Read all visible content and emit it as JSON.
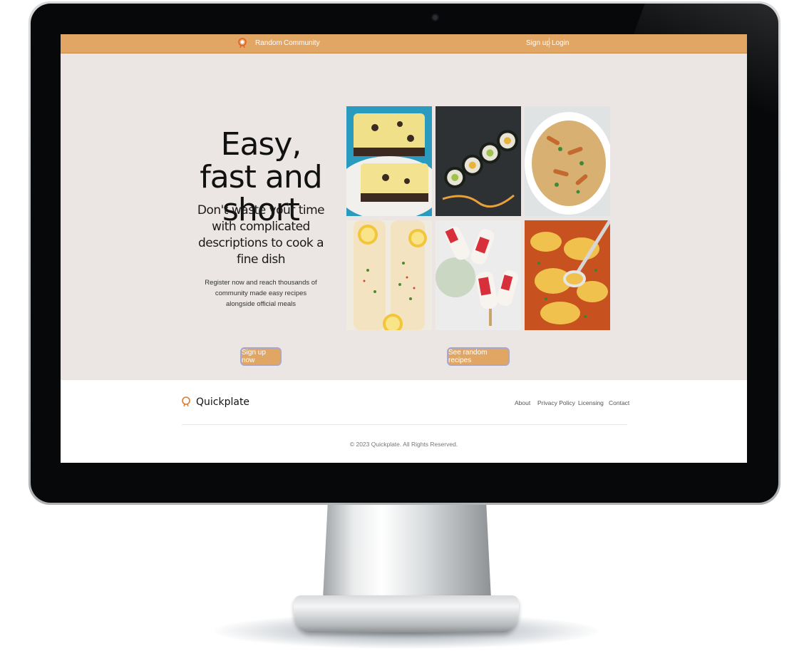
{
  "nav": {
    "links": [
      "Random",
      "Community"
    ],
    "auth": [
      "Sign up",
      "Login"
    ]
  },
  "hero": {
    "title": "Easy, fast and short",
    "subtitle": "Don't waste your time with complicated descriptions to cook a fine dish",
    "description": "Register now and reach thousands of community made easy recipes alongside official meals",
    "signup_button": "Sign up now",
    "random_button": "See random recipes"
  },
  "gallery": {
    "images": [
      "chocolate-chip-bars",
      "sushi-rolls",
      "pasta-casserole",
      "lemon-fish-fillets",
      "strawberry-popsicles",
      "baked-cheese-pasta"
    ]
  },
  "footer": {
    "brand": "Quickplate",
    "links": [
      "About",
      "Privacy Policy",
      "Licensing",
      "Contact"
    ],
    "copyright": "© 2023 Quickplate. All Rights Reserved."
  },
  "colors": {
    "accent": "#e2a664",
    "hero_bg": "#ebe6e4",
    "logo": "#e07b2b"
  }
}
